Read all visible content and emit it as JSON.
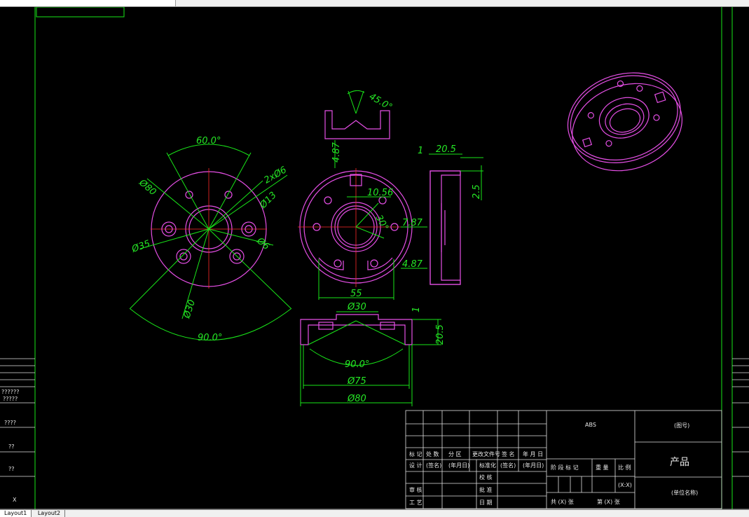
{
  "window": {
    "tabs": [
      "Layout1",
      "Layout2"
    ]
  },
  "dimensions": {
    "view1": {
      "angle_top": "60.0°",
      "dia80": "Ø80",
      "holes": "2xØ6",
      "dia13": "Ø13",
      "dia35": "Ø35",
      "dia6": "Ø6",
      "dia30": "Ø30",
      "angle_bottom": "90.0°"
    },
    "view2": {
      "angle": "45.0°",
      "height": "4.87",
      "width": "10.56",
      "angle2": "30°",
      "right1": "7.87",
      "right2": "4.87",
      "bottom": "55"
    },
    "view3": {
      "thick": "1",
      "width": "20.5",
      "height": "2.5"
    },
    "view4": {
      "dia30": "Ø30",
      "thick": "1",
      "height": "20.5",
      "angle": "90.0°",
      "dia75": "Ø75",
      "dia80": "Ø80"
    }
  },
  "left_strip": [
    "??????",
    "?????",
    "????",
    "??",
    "??",
    "X"
  ],
  "title_block": {
    "material": "ABS",
    "drawing_no": "(图号)",
    "part_name": "产品",
    "company": "(单位名称)",
    "row_headers": [
      "标 记",
      "处 数",
      "分 区",
      "更改文件号",
      "签 名",
      "年 月 日"
    ],
    "design_row": [
      "设 计",
      "(签名)",
      "(年月日)",
      "标准化",
      "(签名)",
      "(年月日)"
    ],
    "left_labels": [
      "审 核",
      "工 艺"
    ],
    "mid_labels": [
      "批 准",
      "日 期"
    ],
    "check_label": "校 核",
    "stage_headers": [
      "阶 段 标 记",
      "重 量",
      "比 例"
    ],
    "sheet_info": [
      "共 (X) 张",
      "第 (X) 张"
    ],
    "scale": "(X:X)"
  }
}
